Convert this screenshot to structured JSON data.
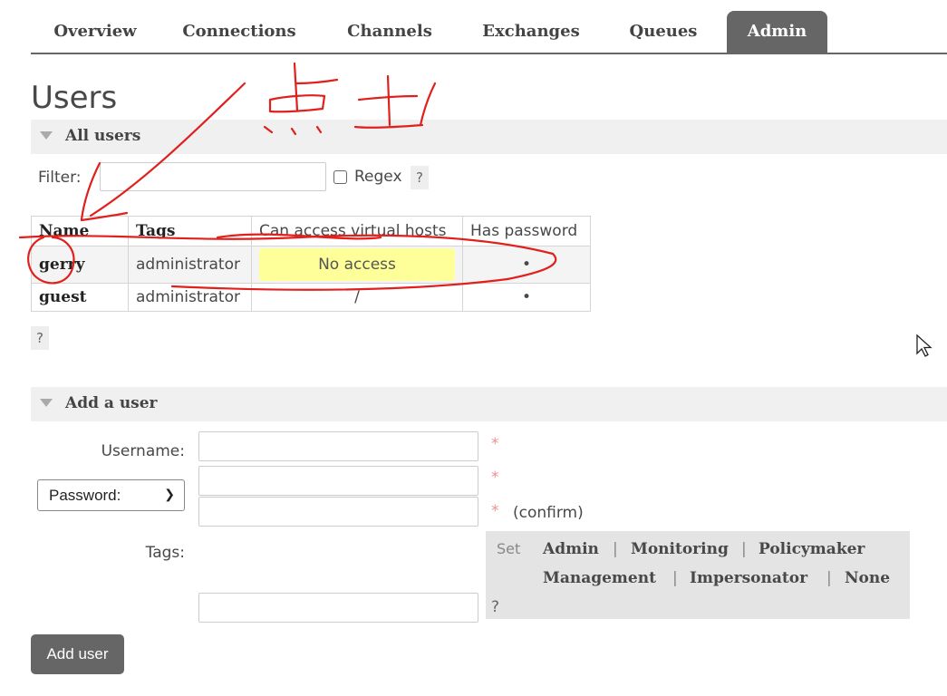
{
  "nav": {
    "tabs": [
      {
        "label": "Overview"
      },
      {
        "label": "Connections"
      },
      {
        "label": "Channels"
      },
      {
        "label": "Exchanges"
      },
      {
        "label": "Queues"
      },
      {
        "label": "Admin",
        "active": true
      }
    ]
  },
  "page_title": "Users",
  "all_users": {
    "header": "All users",
    "filter_label": "Filter:",
    "filter_value": "",
    "regex_label": "Regex",
    "help": "?",
    "table": {
      "columns": [
        "Name",
        "Tags",
        "Can access virtual hosts",
        "Has password"
      ],
      "rows": [
        {
          "name": "gerry",
          "tags": "administrator",
          "vhosts": "No access",
          "has_password": "•"
        },
        {
          "name": "guest",
          "tags": "administrator",
          "vhosts": "/",
          "has_password": "•"
        }
      ]
    },
    "table_help": "?"
  },
  "add_user": {
    "header": "Add a user",
    "username_label": "Username:",
    "password_select": "Password:",
    "required_mark": "*",
    "confirm_label": "(confirm)",
    "tags_label": "Tags:",
    "set_label": "Set",
    "tag_options": [
      "Admin",
      "Monitoring",
      "Policymaker",
      "Management",
      "Impersonator",
      "None"
    ],
    "separator": "|",
    "tags_help": "?",
    "submit_label": "Add user"
  },
  "annotation": {
    "color": "#e0201c"
  }
}
